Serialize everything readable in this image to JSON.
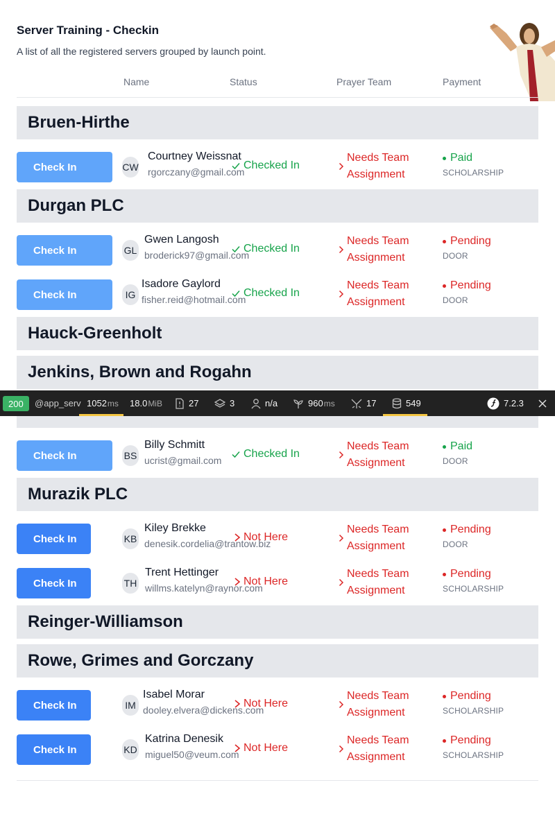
{
  "page": {
    "title": "Server Training - Checkin",
    "subtitle": "A list of all the registered servers grouped by launch point."
  },
  "columns": [
    "Name",
    "Status",
    "Prayer Team",
    "Payment"
  ],
  "groups": [
    {
      "name": "Bruen-Hirthe",
      "rows": [
        {
          "button": "Check In",
          "button_state": "disabled",
          "initials": "CW",
          "name": "Courtney Weissnat",
          "email": "rgorczany@gmail.com",
          "status": "Checked In",
          "team": "Needs Team Assignment",
          "payment": "Paid",
          "method": "SCHOLARSHIP"
        }
      ]
    },
    {
      "name": "Durgan PLC",
      "rows": [
        {
          "button": "Check In",
          "button_state": "disabled",
          "initials": "GL",
          "name": "Gwen Langosh",
          "email": "broderick97@gmail.com",
          "status": "Checked In",
          "team": "Needs Team Assignment",
          "payment": "Pending",
          "method": "DOOR"
        },
        {
          "button": "Check In",
          "button_state": "disabled",
          "initials": "IG",
          "name": "Isadore Gaylord",
          "email": "fisher.reid@hotmail.com",
          "status": "Checked In",
          "team": "Needs Team Assignment",
          "payment": "Pending",
          "method": "DOOR"
        }
      ]
    },
    {
      "name": "Hauck-Greenholt",
      "rows": []
    },
    {
      "name": "Jenkins, Brown and Rogahn",
      "rows": []
    },
    {
      "name": "",
      "rows": [
        {
          "button": "Check In",
          "button_state": "disabled",
          "initials": "BS",
          "name": "Billy Schmitt",
          "email": "ucrist@gmail.com",
          "status": "Checked In",
          "team": "Needs Team Assignment",
          "payment": "Paid",
          "method": "DOOR"
        }
      ]
    },
    {
      "name": "Murazik PLC",
      "rows": [
        {
          "button": "Check In",
          "button_state": "active",
          "initials": "KB",
          "name": "Kiley Brekke",
          "email": "denesik.cordelia@trantow.biz",
          "status": "Not Here",
          "team": "Needs Team Assignment",
          "payment": "Pending",
          "method": "DOOR"
        },
        {
          "button": "Check In",
          "button_state": "active",
          "initials": "TH",
          "name": "Trent Hettinger",
          "email": "willms.katelyn@raynor.com",
          "status": "Not Here",
          "team": "Needs Team Assignment",
          "payment": "Pending",
          "method": "SCHOLARSHIP"
        }
      ]
    },
    {
      "name": "Reinger-Williamson",
      "rows": []
    },
    {
      "name": "Rowe, Grimes and Gorczany",
      "rows": [
        {
          "button": "Check In",
          "button_state": "active",
          "initials": "IM",
          "name": "Isabel Morar",
          "email": "dooley.elvera@dickens.com",
          "status": "Not Here",
          "team": "Needs Team Assignment",
          "payment": "Pending",
          "method": "SCHOLARSHIP"
        },
        {
          "button": "Check In",
          "button_state": "active",
          "initials": "KD",
          "name": "Katrina Denesik",
          "email": "miguel50@veum.com",
          "status": "Not Here",
          "team": "Needs Team Assignment",
          "payment": "Pending",
          "method": "SCHOLARSHIP"
        }
      ]
    }
  ],
  "toolbar": {
    "status_code": "200",
    "route": "@app_serv",
    "time_value": "1052",
    "time_unit": "ms",
    "memory_value": "18.0",
    "memory_unit": "MiB",
    "requests": "27",
    "layers": "3",
    "user": "n/a",
    "twig_value": "960",
    "twig_unit": "ms",
    "events": "17",
    "db_queries": "549",
    "version": "7.2.3"
  },
  "colors": {
    "button_active": "#3b82f6",
    "button_disabled": "#60a5fa",
    "checked_in": "#16a34a",
    "alert": "#dc2626",
    "group_bg": "#e5e7eb",
    "toolbar_bg": "#222222",
    "toolbar_status": "#3ab265"
  }
}
